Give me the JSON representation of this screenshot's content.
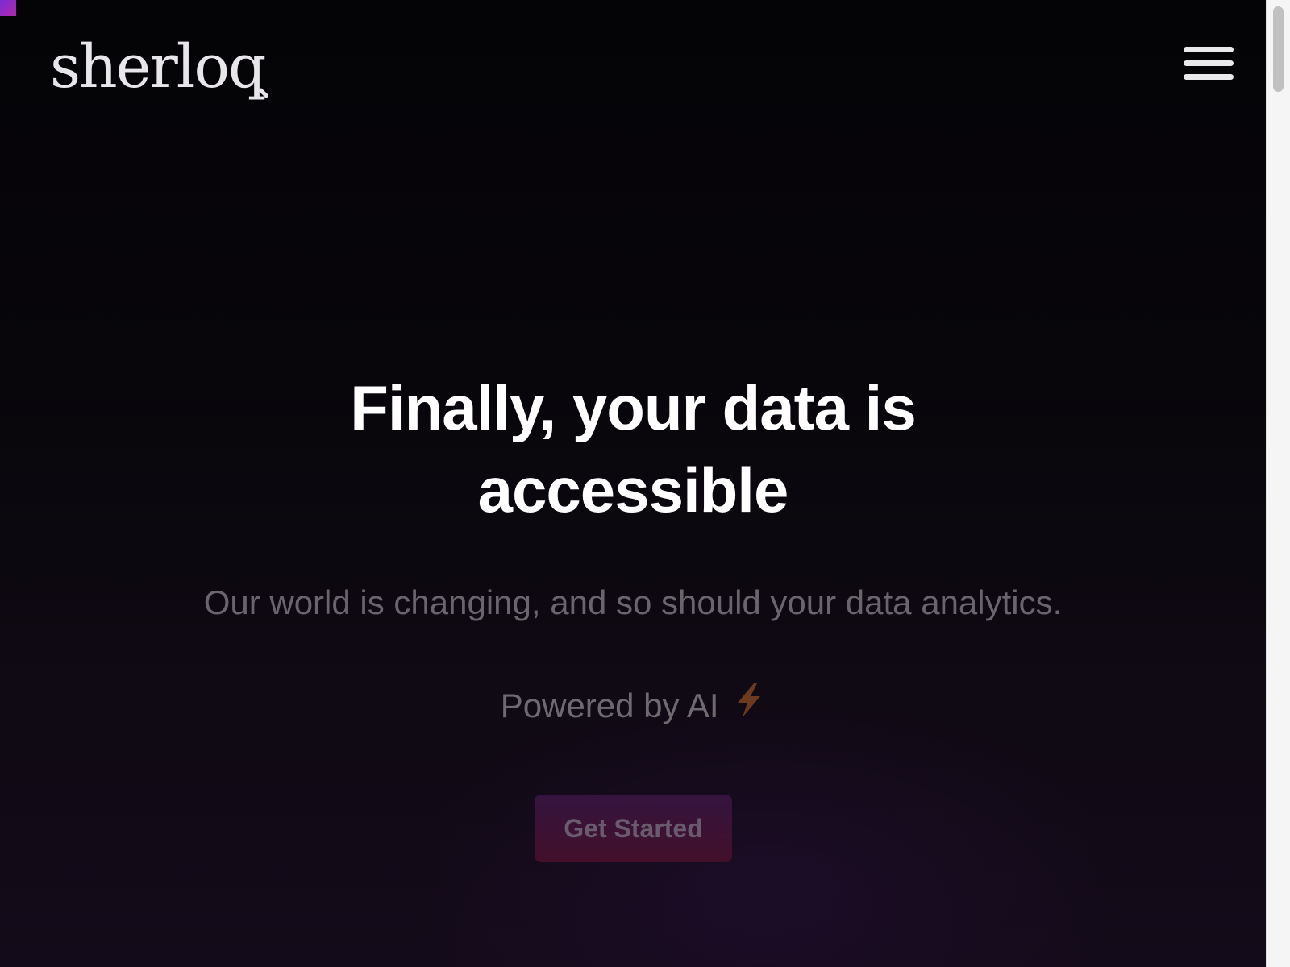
{
  "brand": {
    "logo_text_main": "sherlo",
    "logo_text_q": "q"
  },
  "header": {
    "menu_icon": "hamburger-menu-icon"
  },
  "hero": {
    "title_line1": "Finally, your data is",
    "title_line2": "accessible",
    "subtitle": "Our world is changing, and so should your data analytics.",
    "powered_by": "Powered by AI",
    "powered_icon": "lightning-bolt-icon",
    "cta_label": "Get Started"
  },
  "colors": {
    "background": "#07050a",
    "title": "#ffffff",
    "muted_text": "#6a656d",
    "bolt": "#6b3a1f",
    "cta_start": "#34143f",
    "cta_end": "#43102a",
    "accent_corner": "#7a2bd6"
  }
}
